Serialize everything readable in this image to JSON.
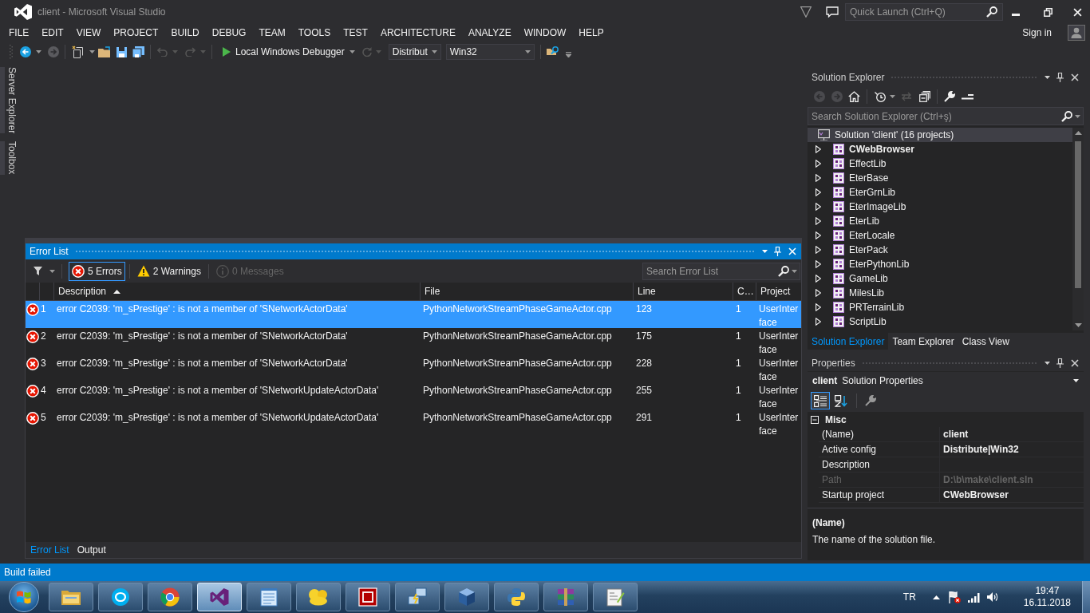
{
  "window": {
    "title": "client - Microsoft Visual Studio"
  },
  "title_bar": {
    "quick_launch": {
      "placeholder": "Quick Launch (Ctrl+Q)"
    }
  },
  "menu": {
    "items": [
      "FILE",
      "EDIT",
      "VIEW",
      "PROJECT",
      "BUILD",
      "DEBUG",
      "TEAM",
      "TOOLS",
      "TEST",
      "ARCHITECTURE",
      "ANALYZE",
      "WINDOW",
      "HELP"
    ],
    "sign_in": "Sign in"
  },
  "toolbar": {
    "debugger": "Local Windows Debugger",
    "configuration": "Distribut",
    "platform": "Win32"
  },
  "side_tabs": [
    "Server Explorer",
    "Toolbox"
  ],
  "error_list": {
    "title": "Error List",
    "active": true,
    "filters": [
      {
        "kind": "error",
        "label": "5 Errors",
        "selected": true,
        "disabled": false
      },
      {
        "kind": "warning",
        "label": "2 Warnings",
        "selected": false,
        "disabled": false
      },
      {
        "kind": "message",
        "label": "0 Messages",
        "selected": false,
        "disabled": true
      }
    ],
    "search": {
      "placeholder": "Search Error List"
    },
    "columns": [
      {
        "label": "Description",
        "sorted": true
      },
      {
        "label": "File",
        "sorted": false
      },
      {
        "label": "Line",
        "sorted": false
      },
      {
        "label": "C…",
        "sorted": false
      },
      {
        "label": "Project",
        "sorted": false
      }
    ],
    "rows": [
      {
        "number": "1",
        "description": "error C2039: 'm_sPrestige' : is not a member of 'SNetworkActorData'",
        "file": "PythonNetworkStreamPhaseGameActor.cpp",
        "line": "123",
        "column_4": "1",
        "project": "UserInterface",
        "selected": true
      },
      {
        "number": "2",
        "description": "error C2039: 'm_sPrestige' : is not a member of 'SNetworkActorData'",
        "file": "PythonNetworkStreamPhaseGameActor.cpp",
        "line": "175",
        "column_4": "1",
        "project": "UserInterface",
        "selected": false
      },
      {
        "number": "3",
        "description": "error C2039: 'm_sPrestige' : is not a member of 'SNetworkActorData'",
        "file": "PythonNetworkStreamPhaseGameActor.cpp",
        "line": "228",
        "column_4": "1",
        "project": "UserInterface",
        "selected": false
      },
      {
        "number": "4",
        "description": "error C2039: 'm_sPrestige' : is not a member of 'SNetworkUpdateActorData'",
        "file": "PythonNetworkStreamPhaseGameActor.cpp",
        "line": "255",
        "column_4": "1",
        "project": "UserInterface",
        "selected": false
      },
      {
        "number": "5",
        "description": "error C2039: 'm_sPrestige' : is not a member of 'SNetworkUpdateActorData'",
        "file": "PythonNetworkStreamPhaseGameActor.cpp",
        "line": "291",
        "column_4": "1",
        "project": "UserInterface",
        "selected": false
      }
    ],
    "tabs": [
      {
        "label": "Error List",
        "selected": true
      },
      {
        "label": "Output",
        "selected": false
      }
    ]
  },
  "status_bar": {
    "text": "Build failed"
  },
  "solution_explorer": {
    "title": "Solution Explorer",
    "active": false,
    "search": {
      "placeholder": "Search Solution Explorer (Ctrl+ş)"
    },
    "tree": {
      "label": "Solution 'client' (16 projects)",
      "selected": true,
      "children": [
        {
          "label": "CWebBrowser",
          "startup": true,
          "expanded": false,
          "selected": false
        },
        {
          "label": "EffectLib",
          "startup": false,
          "expanded": false,
          "selected": false
        },
        {
          "label": "EterBase",
          "startup": false,
          "expanded": false,
          "selected": false
        },
        {
          "label": "EterGrnLib",
          "startup": false,
          "expanded": false,
          "selected": false
        },
        {
          "label": "EterImageLib",
          "startup": false,
          "expanded": false,
          "selected": false
        },
        {
          "label": "EterLib",
          "startup": false,
          "expanded": false,
          "selected": false
        },
        {
          "label": "EterLocale",
          "startup": false,
          "expanded": false,
          "selected": false
        },
        {
          "label": "EterPack",
          "startup": false,
          "expanded": false,
          "selected": false
        },
        {
          "label": "EterPythonLib",
          "startup": false,
          "expanded": false,
          "selected": false
        },
        {
          "label": "GameLib",
          "startup": false,
          "expanded": false,
          "selected": false
        },
        {
          "label": "MilesLib",
          "startup": false,
          "expanded": false,
          "selected": false
        },
        {
          "label": "PRTerrainLib",
          "startup": false,
          "expanded": false,
          "selected": false
        },
        {
          "label": "ScriptLib",
          "startup": false,
          "expanded": false,
          "selected": false
        }
      ]
    },
    "tabs": [
      {
        "label": "Solution Explorer",
        "selected": true
      },
      {
        "label": "Team Explorer",
        "selected": false
      },
      {
        "label": "Class View",
        "selected": false
      }
    ]
  },
  "properties": {
    "title": "Properties",
    "active": false,
    "object": {
      "name": "client",
      "type": "Solution Properties"
    },
    "views": [
      {
        "kind": "categorized",
        "selected": true
      },
      {
        "kind": "alphabetical",
        "selected": false
      }
    ],
    "categories": [
      {
        "label": "Misc",
        "expanded": true,
        "rows": [
          {
            "name": "(Name)",
            "value": "client",
            "disabled": false
          },
          {
            "name": "Active config",
            "value": "Distribute|Win32",
            "disabled": false
          },
          {
            "name": "Description",
            "disabled": false
          },
          {
            "name": "Path",
            "value": "D:\\b\\make\\client.sln",
            "disabled": true
          },
          {
            "name": "Startup project",
            "value": "CWebBrowser",
            "disabled": false
          }
        ]
      }
    ],
    "description": {
      "title": "(Name)",
      "text": "The name of the solution file."
    }
  },
  "taskbar": {
    "apps": [
      {
        "kind": "explorer",
        "active": false
      },
      {
        "kind": "skype",
        "active": false
      },
      {
        "kind": "chrome",
        "active": false
      },
      {
        "kind": "visual_studio",
        "active": true
      },
      {
        "kind": "notepad",
        "active": false
      },
      {
        "kind": "cloud",
        "active": false
      },
      {
        "kind": "filezilla",
        "active": false
      },
      {
        "kind": "network",
        "active": false
      },
      {
        "kind": "virtualbox",
        "active": false
      },
      {
        "kind": "python",
        "active": false
      },
      {
        "kind": "winrar",
        "active": false
      },
      {
        "kind": "notepad_plus",
        "active": false
      }
    ],
    "language": "TR",
    "time": "19:47",
    "date": "16.11.2018"
  }
}
